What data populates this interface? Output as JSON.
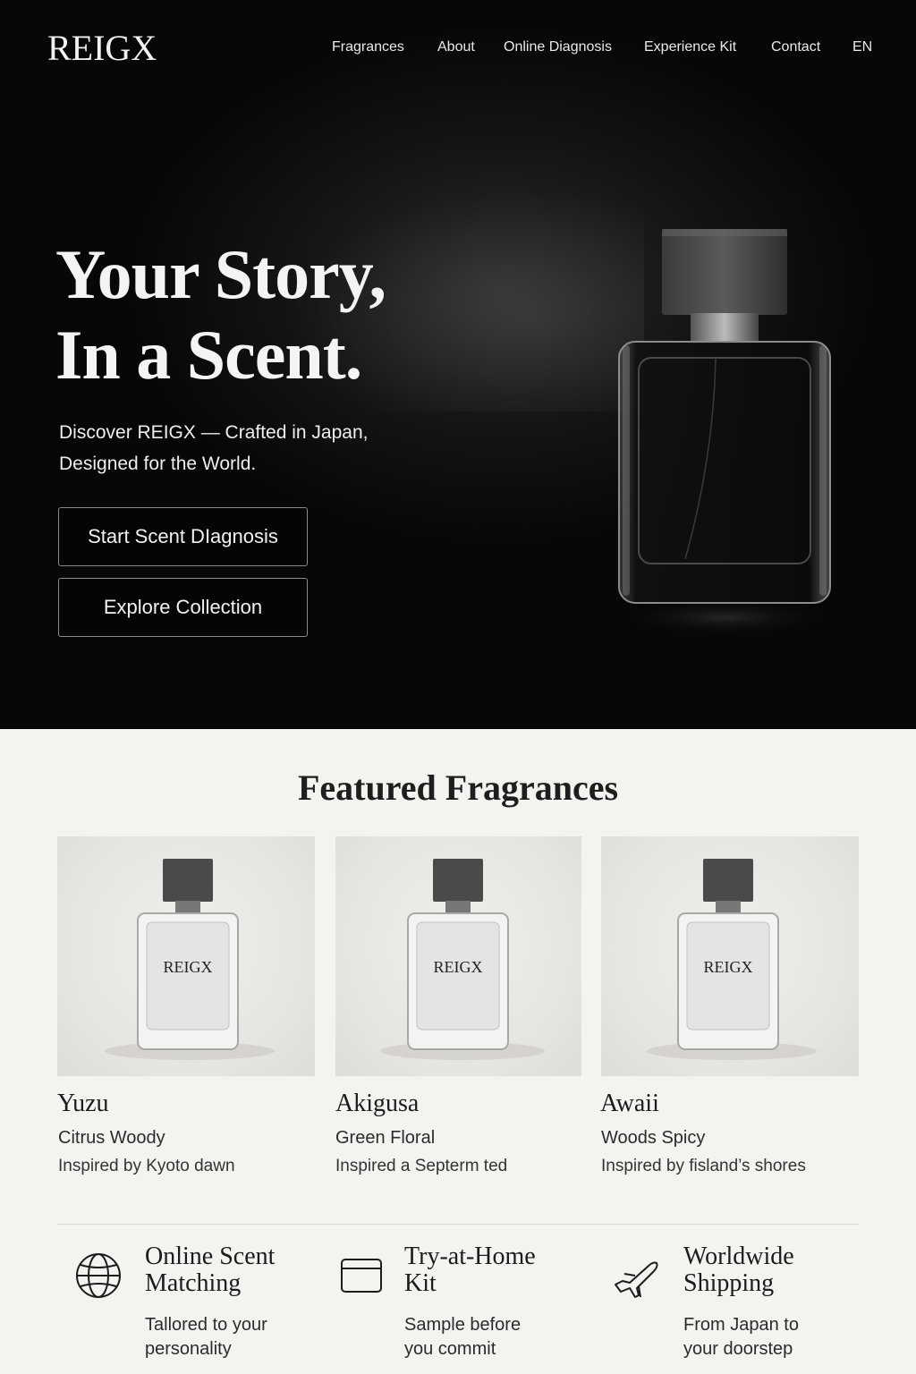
{
  "brand": {
    "logo": "REIGX"
  },
  "nav": {
    "items": [
      {
        "label": "Fragrances"
      },
      {
        "label": "About"
      },
      {
        "label": "Online Diagnosis"
      },
      {
        "label": "Experience Kit"
      },
      {
        "label": "Contact"
      },
      {
        "label": "EN"
      }
    ]
  },
  "hero": {
    "headline_line1": "Your Story,",
    "headline_line2": "In a Scent.",
    "subline_line1": "Discover REIGX — Crafted in Japan,",
    "subline_line2": "Designed for the World.",
    "primary_button": "Start Scent DIagnosis",
    "secondary_button": "Explore Collection"
  },
  "featured": {
    "title": "Featured Fragrances",
    "bottle_label": "REIGX",
    "products": [
      {
        "name": "Yuzu",
        "type": "Citrus Woody",
        "description": "Inspired by Kyoto dawn"
      },
      {
        "name": "Akigusa",
        "type": "Green Floral",
        "description": "Inspired a Septerm ted"
      },
      {
        "name": "Awaii",
        "type": "Woods Spicy",
        "description": "Inspired by fisland’s shores"
      }
    ]
  },
  "features": [
    {
      "title_line1": "Online Scent",
      "title_line2": "Matching",
      "desc_line1": "Tallored to your",
      "desc_line2": "personality",
      "icon": "globe-icon"
    },
    {
      "title_line1": "Try-at-Home",
      "title_line2": "Kit",
      "desc_line1": "Sample before",
      "desc_line2": "you commit",
      "icon": "box-icon"
    },
    {
      "title_line1": "Worldwide",
      "title_line2": "Shipping",
      "desc_line1": "From Japan to",
      "desc_line2": "your doorstep",
      "icon": "airplane-icon"
    }
  ]
}
